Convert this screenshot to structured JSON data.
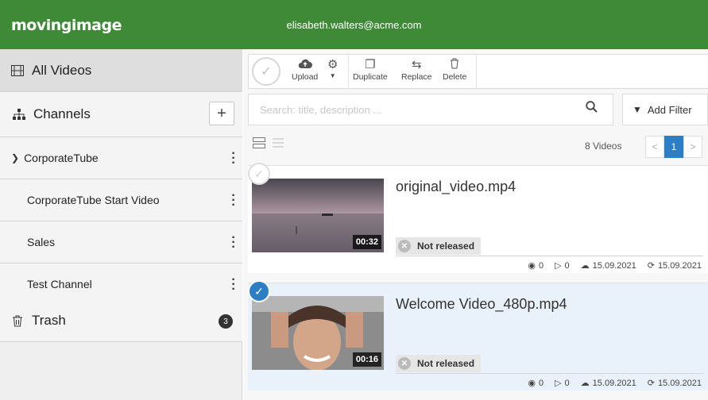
{
  "header": {
    "logo": "movingimage",
    "user_email": "elisabeth.walters@acme.com"
  },
  "sidebar": {
    "all_videos": "All Videos",
    "channels": "Channels",
    "add_channel": "+",
    "items": [
      {
        "label": "CorporateTube",
        "expander": "›"
      },
      {
        "label": "CorporateTube Start Video"
      },
      {
        "label": "Sales"
      },
      {
        "label": "Test Channel"
      }
    ],
    "trash": {
      "label": "Trash",
      "count": "3"
    }
  },
  "toolbar": {
    "upload": "Upload",
    "duplicate": "Duplicate",
    "replace": "Replace",
    "delete": "Delete"
  },
  "search": {
    "placeholder": "Search: title, description ...",
    "add_filter": "Add Filter"
  },
  "list": {
    "count": "8 Videos",
    "page": "1",
    "prev": "<",
    "next": ">"
  },
  "videos": [
    {
      "title": "original_video.mp4",
      "duration": "00:32",
      "status": "Not released",
      "views": "0",
      "plays": "0",
      "uploaded": "15.09.2021",
      "modified": "15.09.2021",
      "selected": false
    },
    {
      "title": "Welcome Video_480p.mp4",
      "duration": "00:16",
      "status": "Not released",
      "views": "0",
      "plays": "0",
      "uploaded": "15.09.2021",
      "modified": "15.09.2021",
      "selected": true
    }
  ],
  "colors": {
    "header_bg": "#3f8a37",
    "accent": "#2c7fc7"
  }
}
